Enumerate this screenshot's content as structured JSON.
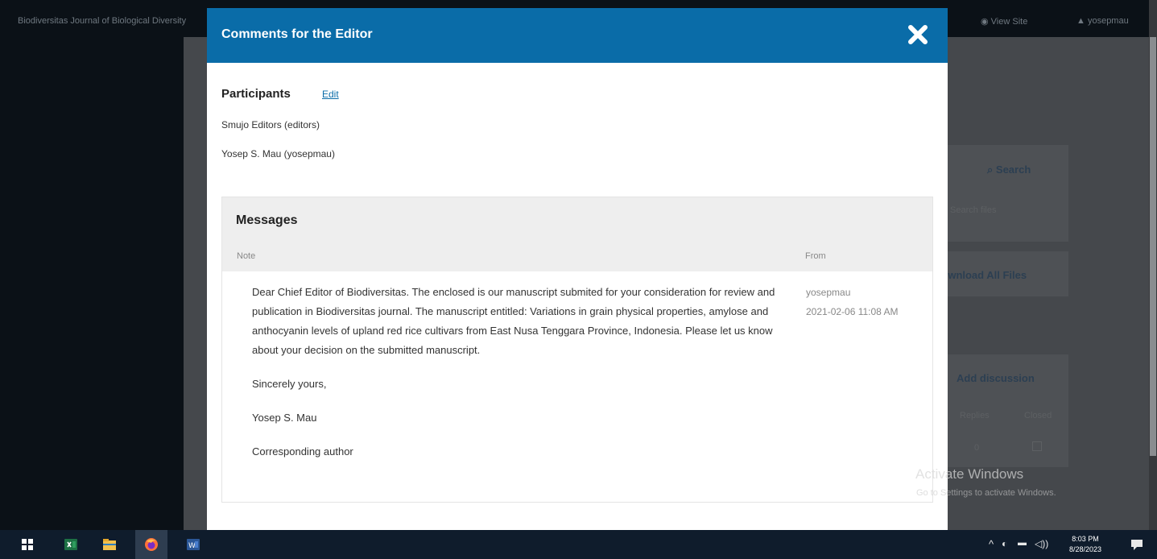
{
  "background": {
    "site_title": "Biodiversitas Journal of Biological Diversity",
    "view_site_label": "View Site",
    "user_label": "yosepmau",
    "search_label": "Search",
    "search_placeholder": "Search files",
    "download_all_label": "Download All Files",
    "add_discussion_label": "Add discussion",
    "col_replies": "Replies",
    "col_closed": "Closed",
    "replies_count": "0"
  },
  "modal": {
    "title": "Comments for the Editor",
    "participants_heading": "Participants",
    "edit_label": "Edit",
    "participants": [
      "Smujo Editors (editors)",
      "Yosep S. Mau (yosepmau)"
    ],
    "messages": {
      "title": "Messages",
      "col_note": "Note",
      "col_from": "From",
      "note_paragraphs": [
        "Dear Chief Editor of Biodiversitas. The enclosed is our manuscript submited for your consideration for review and publication in Biodiversitas journal. The manuscript entitled: Variations in grain physical properties, amylose and anthocyanin levels of upland red rice cultivars from East Nusa Tenggara Province, Indonesia.  Please let us know about your decision on the submitted manuscript.",
        "Sincerely yours,",
        "Yosep S. Mau",
        "Corresponding author"
      ],
      "from_user": "yosepmau",
      "from_date": "2021-02-06 11:08 AM"
    }
  },
  "watermark": {
    "line1": "Activate Windows",
    "line2": "Go to Settings to activate Windows."
  },
  "taskbar": {
    "time": "8:03 PM",
    "date": "8/28/2023",
    "apps": [
      "windows-start",
      "excel",
      "file-explorer",
      "firefox",
      "word"
    ]
  }
}
